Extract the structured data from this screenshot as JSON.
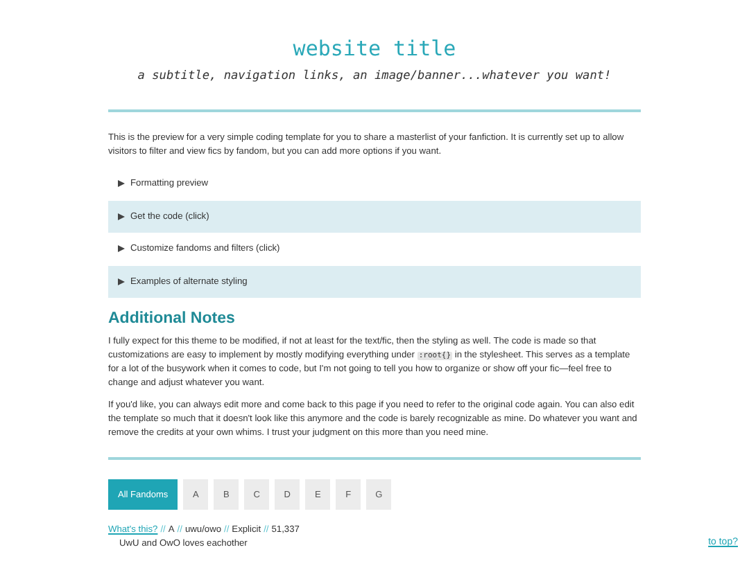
{
  "header": {
    "title": "website title",
    "subtitle": "a subtitle, navigation links, an image/banner...whatever you want!"
  },
  "intro": "This is the preview for a very simple coding template for you to share a masterlist of your fanfiction. It is currently set up to allow visitors to filter and view fics by fandom, but you can add more options if you want.",
  "sections": [
    {
      "label": "Formatting preview",
      "expanded": false
    },
    {
      "label": "Get the code (click)",
      "expanded": false
    },
    {
      "label": "Customize fandoms and filters (click)",
      "expanded": false
    },
    {
      "label": "Examples of alternate styling",
      "expanded": false
    }
  ],
  "notes": {
    "heading": "Additional Notes",
    "paragraphs": [
      [
        {
          "kind": "text",
          "text": "I fully expect for this theme to be modified, if not at least for the text/fic, then the styling as well. The code is made so that customizations are easy to implement by mostly modifying everything under "
        },
        {
          "kind": "code",
          "text": ":root{}"
        },
        {
          "kind": "text",
          "text": " in the stylesheet. This serves as a template for a lot of the busywork when it comes to code, but I'm not going to tell you how to organize or show off your fic—feel free to change and adjust whatever you want."
        }
      ],
      [
        {
          "kind": "text",
          "text": "If you'd like, you can always edit more and come back to this page if you need to refer to the original code again. You can also edit the template so much that it doesn't look like this anymore and the code is barely recognizable as mine. Do whatever you want and remove the credits at your own whims. I trust your judgment on this more than you need mine."
        }
      ]
    ]
  },
  "filters": [
    {
      "label": "All Fandoms",
      "selected": true
    },
    {
      "label": "A",
      "selected": false
    },
    {
      "label": "B",
      "selected": false
    },
    {
      "label": "C",
      "selected": false
    },
    {
      "label": "D",
      "selected": false
    },
    {
      "label": "E",
      "selected": false
    },
    {
      "label": "F",
      "selected": false
    },
    {
      "label": "G",
      "selected": false
    }
  ],
  "fic": {
    "link": "What's this?",
    "meta": [
      {
        "separator": "//",
        "text": "A"
      },
      {
        "separator": "//",
        "text": "uwu/owo"
      },
      {
        "separator": "//",
        "text": "Explicit"
      },
      {
        "separator": "//",
        "text": "51,337"
      }
    ],
    "summary": "UwU and OwO loves eachother"
  },
  "to_top": "to top?"
}
